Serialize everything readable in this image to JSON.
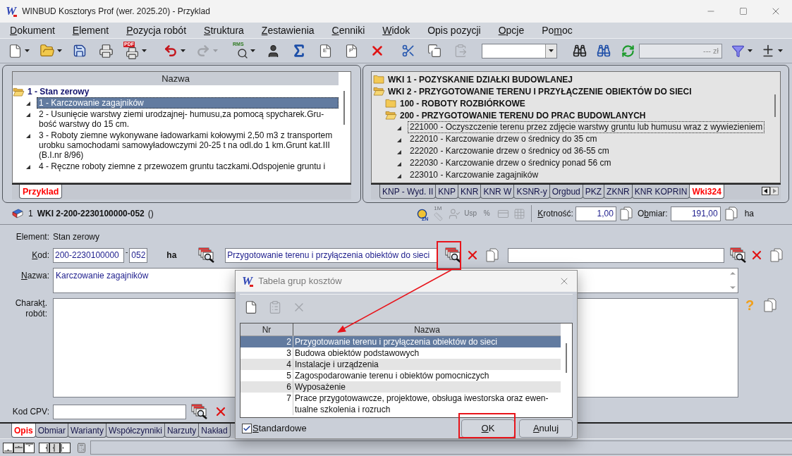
{
  "window": {
    "logo": "W",
    "title": "WINBUD Kosztorys Prof (wer. 2025.20) - Przyklad"
  },
  "menu": [
    {
      "key": "D",
      "post": "okument"
    },
    {
      "key": "E",
      "post": "lement"
    },
    {
      "key": "P",
      "post": "ozycja robót"
    },
    {
      "key": "S",
      "post": "truktura"
    },
    {
      "key": "Z",
      "post": "estawienia"
    },
    {
      "key": "C",
      "post": "enniki"
    },
    {
      "key": "W",
      "post": "idok"
    },
    {
      "pre": "Opis pozycji"
    },
    {
      "key": "O",
      "post": "pcje"
    },
    {
      "pre": "Po",
      "key": "m",
      "post": "oc"
    }
  ],
  "toolbar": [
    [
      {
        "kind": "new",
        "dropdown": true,
        "disabled": false
      },
      {
        "kind": "open",
        "dropdown": true,
        "disabled": false
      },
      {
        "kind": "save",
        "dropdown": false,
        "disabled": false
      },
      {
        "kind": "print",
        "dropdown": false,
        "disabled": false
      },
      {
        "kind": "pdf",
        "label": "PDF",
        "dropdown": true,
        "disabled": false
      }
    ],
    [
      {
        "kind": "undo",
        "dropdown": true,
        "disabled": false
      },
      {
        "kind": "redo",
        "dropdown": true,
        "disabled": true
      }
    ],
    [
      {
        "kind": "rms",
        "label": "RMS",
        "dropdown": true,
        "disabled": false
      },
      {
        "kind": "person",
        "dropdown": false,
        "disabled": false
      },
      {
        "kind": "sum",
        "dropdown": false,
        "disabled": false
      },
      {
        "kind": "page",
        "label": "E",
        "dropdown": false,
        "disabled": false
      },
      {
        "kind": "page",
        "label": "P",
        "dropdown": false,
        "disabled": false
      },
      {
        "kind": "delete",
        "dropdown": false,
        "disabled": false
      }
    ],
    [
      {
        "kind": "cut",
        "dropdown": false,
        "disabled": false
      },
      {
        "kind": "copy",
        "dropdown": false,
        "disabled": false
      },
      {
        "kind": "paste",
        "dropdown": false,
        "disabled": true
      }
    ],
    [
      {
        "kind": "combo"
      }
    ],
    [
      {
        "kind": "find",
        "dropdown": false,
        "disabled": false
      },
      {
        "kind": "find-next",
        "dropdown": false,
        "disabled": false
      },
      {
        "kind": "refresh",
        "dropdown": false,
        "disabled": false
      }
    ],
    [
      {
        "kind": "amount",
        "value": "--- zł",
        "disabled": true
      }
    ],
    [
      {
        "kind": "filter",
        "dropdown": true,
        "disabled": false
      },
      {
        "kind": "plus-minus",
        "dropdown": true,
        "disabled": false
      }
    ]
  ],
  "left_panel": {
    "header": "Nazwa",
    "tree": [
      {
        "kind": "folder",
        "label": "1 - Stan zerowy",
        "expanded": true,
        "children": [
          {
            "kind": "item",
            "label": "1 - Karczowanie zagajników",
            "selected": true
          },
          {
            "kind": "item",
            "label": "2 - Usunięcie warstwy ziemi urodzajnej- humusu,za pomocą spycharek.Gru-bość warstwy do 15 cm.",
            "selected": false
          },
          {
            "kind": "item",
            "label": "3 - Roboty ziemne wykonywane ładowarkami kołowymi 2,50 m3 z transportem urobku samochodami samowyładowczymi 20-25 t na odl.do 1 km.Grunt kat.III (B.I.nr 8/96)",
            "selected": false
          },
          {
            "kind": "item",
            "label": "4 - Ręczne roboty ziemne z przewozem gruntu taczkami.Odspojenie gruntu i",
            "selected": false
          }
        ]
      }
    ],
    "tabs": [
      {
        "label": "Przyklad",
        "selected": true
      }
    ]
  },
  "right_panel": {
    "tree": [
      {
        "kind": "folder",
        "label": "WKI 1 - POZYSKANIE DZIAŁKI BUDOWLANEJ",
        "expanded": false
      },
      {
        "kind": "folder",
        "label": "WKI 2 - PRZYGOTOWANIE TERENU I PRZYŁĄCZENIE OBIEKTÓW DO SIECI",
        "expanded": true,
        "children": [
          {
            "kind": "folder",
            "label": "100 - ROBOTY ROZBIÓRKOWE",
            "expanded": false
          },
          {
            "kind": "folder",
            "label": "200 - PRZYGOTOWANIE TERENU DO PRAC BUDOWLANYCH",
            "expanded": true,
            "children": [
              {
                "kind": "item",
                "label": "221000 - Oczyszczenie terenu przez zdjęcie warstwy gruntu lub humusu wraz z wywiezieniem",
                "focused": true
              },
              {
                "kind": "item",
                "label": "222010 - Karczowanie drzew o średnicy do 35 cm",
                "focused": false
              },
              {
                "kind": "item",
                "label": "222020 - Karczowanie drzew o średnicy od 36-55 cm",
                "focused": false
              },
              {
                "kind": "item",
                "label": "222030 - Karczowanie drzew o średnicy ponad 56 cm",
                "focused": false
              },
              {
                "kind": "item",
                "label": "223010 - Karczowanie zagajników",
                "focused": false
              }
            ]
          }
        ]
      }
    ],
    "tabs": [
      {
        "label": "KNP - Wyd. II",
        "selected": false
      },
      {
        "label": "KNP",
        "selected": false
      },
      {
        "label": "KNR",
        "selected": false
      },
      {
        "label": "KNR W",
        "selected": false
      },
      {
        "label": "KSNR-y",
        "selected": false
      },
      {
        "label": "Orgbud",
        "selected": false
      },
      {
        "label": "PKZ",
        "selected": false
      },
      {
        "label": "ZKNR",
        "selected": false
      },
      {
        "label": "KNR KOPRIN",
        "selected": false
      },
      {
        "label": "Wki324",
        "selected": true
      }
    ]
  },
  "record": {
    "number": "1",
    "code": "WKI 2-200-2230100000-052",
    "note": "()",
    "tools": [
      {
        "kind": "coin",
        "label": "ZN",
        "disabled": false
      },
      {
        "kind": "ruler",
        "label": "1M",
        "disabled": true
      },
      {
        "kind": "person",
        "disabled": true
      },
      {
        "kind": "text",
        "label": "Usp",
        "disabled": true
      },
      {
        "kind": "text",
        "label": "%",
        "disabled": true
      },
      {
        "kind": "card",
        "disabled": true
      },
      {
        "kind": "grid",
        "disabled": true
      }
    ],
    "multiplier": {
      "label": {
        "key": "K",
        "post": "rotność:"
      },
      "value": "1,00"
    },
    "quantity": {
      "label": {
        "pre": "O",
        "key": "b",
        "post": "miar:"
      },
      "value": "191,00",
      "unit": "ha"
    }
  },
  "form": {
    "element": {
      "label": "Element:",
      "value": "Stan zerowy"
    },
    "code": {
      "label": {
        "key": "K",
        "post": "od:"
      },
      "value": "200-2230100000",
      "separator": "-",
      "suffix": "052",
      "unit": "ha",
      "group": "Przygotowanie terenu i przyłączenia obiektów do sieci"
    },
    "name": {
      "label": {
        "key": "N",
        "post": "azwa:"
      },
      "value": "Karczowanie zagajników"
    },
    "description": {
      "label": {
        "pre": "Charak",
        "key": "t",
        "post": ". robót:"
      },
      "help": "?"
    },
    "cpv": {
      "label": "Kod CPV:"
    }
  },
  "tabs": [
    {
      "label": "Opis",
      "selected": true
    },
    {
      "label": "Obmiar",
      "selected": false
    },
    {
      "label": "Warianty",
      "selected": false
    },
    {
      "label": "Współczynniki",
      "selected": false
    },
    {
      "label": "Narzuty",
      "selected": false
    },
    {
      "label": "Nakład",
      "selected": false
    }
  ],
  "dialog": {
    "logo": "W",
    "title": "Tabela grup kosztów",
    "toolbar": [
      {
        "kind": "new",
        "disabled": false
      },
      {
        "kind": "edit",
        "disabled": true
      },
      {
        "kind": "delete",
        "disabled": true
      }
    ],
    "columns": [
      "Nr",
      "Nazwa"
    ],
    "rows": [
      {
        "nr": "2",
        "name": "Przygotowanie terenu i przyłączenia obiektów do sieci",
        "selected": true
      },
      {
        "nr": "3",
        "name": "Budowa obiektów podstawowych",
        "selected": false
      },
      {
        "nr": "4",
        "name": "Instalacje i urządzenia",
        "selected": false
      },
      {
        "nr": "5",
        "name": "Zagospodarowanie terenu i obiektów pomocniczych",
        "selected": false
      },
      {
        "nr": "6",
        "name": "Wyposażenie",
        "selected": false
      },
      {
        "nr": "7",
        "name": "Prace przygotowawcze, projektowe, obsługa iwestorska oraz ewen-tualne szkolenia i rozruch",
        "selected": false
      }
    ],
    "checkbox": {
      "label": {
        "key": "S",
        "post": "tandardowe"
      },
      "checked": true
    },
    "buttons": [
      {
        "key": "O",
        "post": "K"
      },
      {
        "key": "A",
        "post": "nuluj"
      }
    ]
  }
}
